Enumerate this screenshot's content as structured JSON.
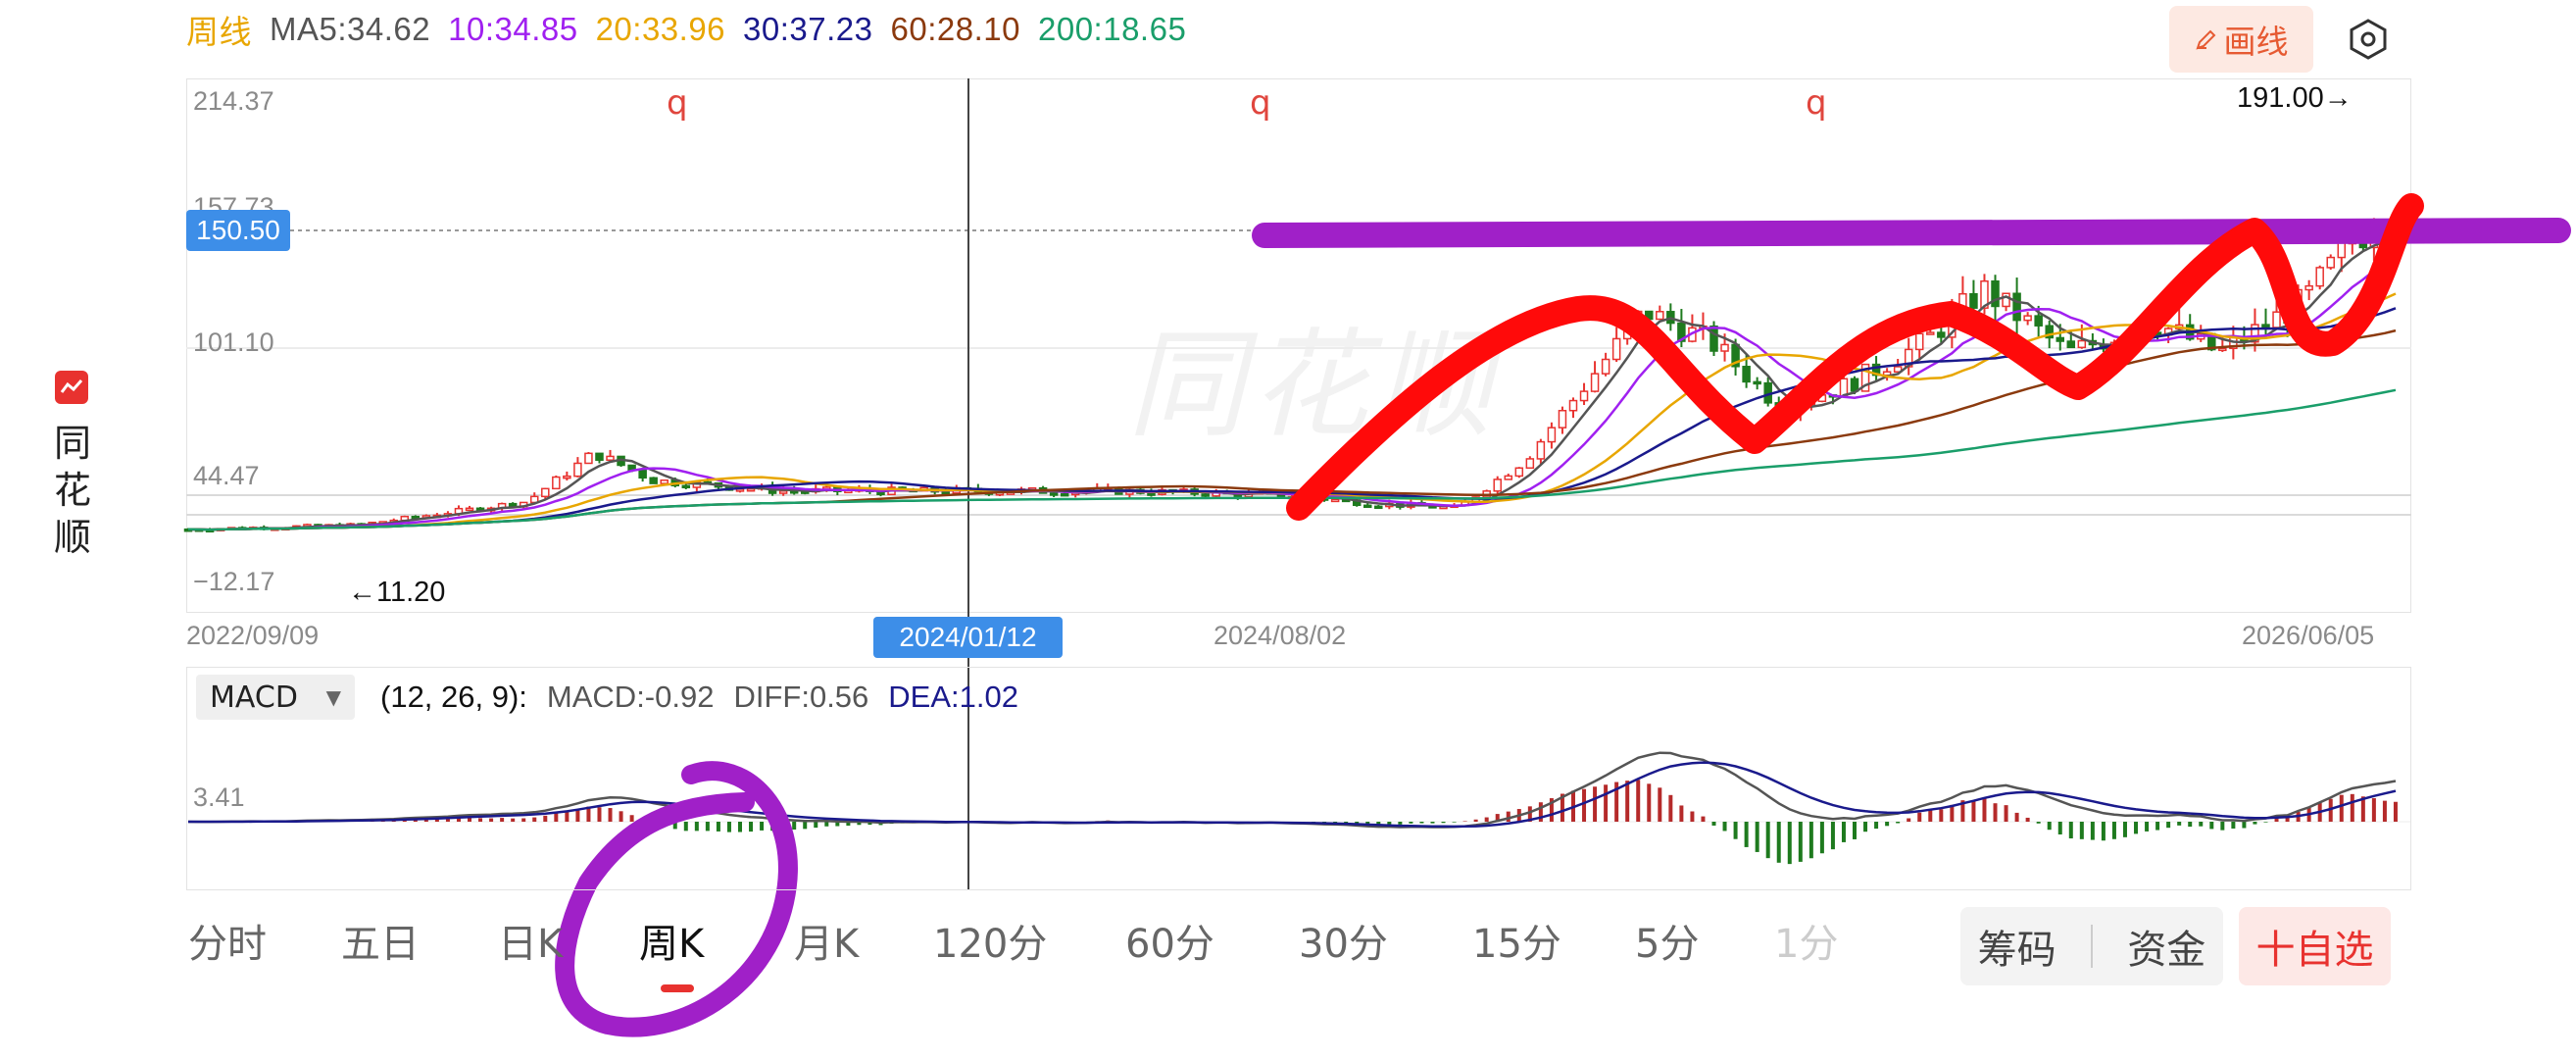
{
  "header": {
    "period_label": "周线",
    "ma_items": [
      {
        "label": "MA5:34.62",
        "color": "#555555"
      },
      {
        "label": "10:34.85",
        "color": "#a020f0"
      },
      {
        "label": "20:33.96",
        "color": "#e8a600"
      },
      {
        "label": "30:37.23",
        "color": "#1a1a8c"
      },
      {
        "label": "60:28.10",
        "color": "#8b3a0e"
      },
      {
        "label": "200:18.65",
        "color": "#1a9e6a"
      }
    ],
    "draw_button_label": "画线",
    "draw_icon": "pencil-icon",
    "settings_icon": "hexagon-settings-icon"
  },
  "brand": {
    "icon": "tonghuashun-logo-icon",
    "chars": [
      "同",
      "花",
      "顺"
    ],
    "watermark": "同花顺"
  },
  "price_axis": {
    "labels": [
      "214.37",
      "157.73",
      "101.10",
      "44.47",
      "−12.17"
    ],
    "current_price_tag": "150.50"
  },
  "date_axis": {
    "labels": [
      "2022/09/09",
      "2024/08/02",
      "2026/06/05"
    ],
    "crosshair_date": "2024/01/12"
  },
  "annotations": {
    "high_label": "191.00→",
    "low_label": "←11.20",
    "q_marks": [
      "q",
      "q",
      "q"
    ]
  },
  "macd": {
    "indicator_select": "MACD",
    "params": "(12, 26, 9):",
    "macd_value": "MACD:-0.92",
    "diff_value": "DIFF:0.56",
    "dea_value": "DEA:1.02",
    "axis_label": "3.41",
    "colors": {
      "macd": "#555555",
      "diff": "#555555",
      "dea": "#1a1a8c"
    }
  },
  "tabs": {
    "items": [
      "分时",
      "五日",
      "日K",
      "周K",
      "月K",
      "120分",
      "60分",
      "30分",
      "15分",
      "5分",
      "1分"
    ],
    "active": "周K"
  },
  "bottom_buttons": {
    "chips": "筹码",
    "funds": "资金",
    "add_watch": "十自选"
  },
  "colors": {
    "up": "#e8322f",
    "down": "#1e7a1e",
    "accent_blue": "#3d8ee8",
    "marker_red": "#ff0a0a",
    "marker_purple": "#a020c8"
  }
}
